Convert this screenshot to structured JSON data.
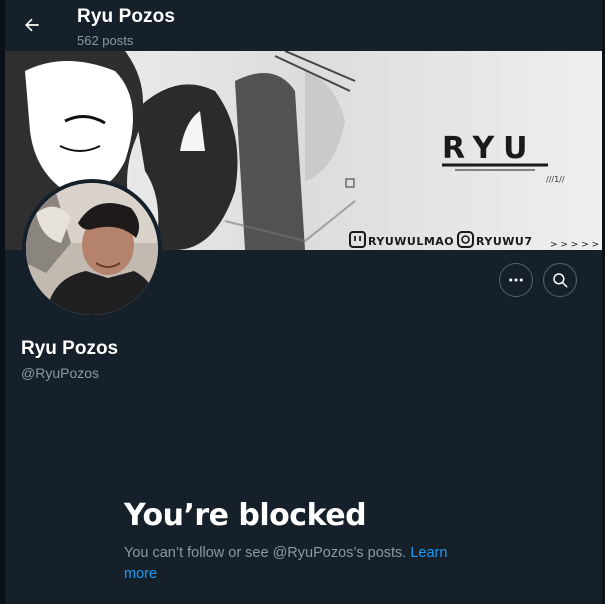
{
  "header": {
    "title": "Ryu Pozos",
    "posts_count": "562 posts"
  },
  "banner": {
    "logo_text": "RYU",
    "small_mark": "///1//",
    "twitch_handle": "RYUWULMAO",
    "instagram_handle": "RYUWU7",
    "arrows": "> > > > >"
  },
  "profile": {
    "name": "Ryu Pozos",
    "handle": "@RyuPozos"
  },
  "blocked": {
    "title": "You’re blocked",
    "message": "You can’t follow or see @RyuPozos’s posts.",
    "link": "Learn more"
  },
  "icons": {
    "back": "arrow-left-icon",
    "more": "more-horizontal-icon",
    "search": "search-icon"
  },
  "colors": {
    "background": "#15202b",
    "secondary_text": "#8b98a5",
    "link": "#1d9bf0"
  }
}
